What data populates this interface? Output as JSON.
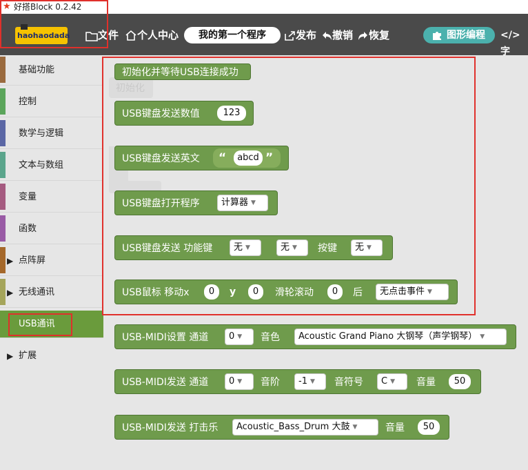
{
  "window": {
    "title": "好搭Block 0.2.42"
  },
  "header": {
    "logo_text": "haohaodada",
    "file_label": "文件",
    "personal_label": "个人中心",
    "project_name": "我的第一个程序",
    "publish_label": "发布",
    "undo_label": "撤销",
    "redo_label": "恢复",
    "graphic_tab_label": "图形编程",
    "code_tab_label": "字"
  },
  "sidebar": {
    "items": [
      {
        "label": "基础功能",
        "color": "#9a6a3e"
      },
      {
        "label": "控制",
        "color": "#5ba55b"
      },
      {
        "label": "数学与逻辑",
        "color": "#5b67a5"
      },
      {
        "label": "文本与数组",
        "color": "#5ba58c"
      },
      {
        "label": "变量",
        "color": "#a55b80"
      },
      {
        "label": "函数",
        "color": "#995ba5"
      },
      {
        "label": "点阵屏",
        "color": "#a5682a"
      },
      {
        "label": "无线通讯",
        "color": "#a5a55b"
      },
      {
        "label": "USB通讯",
        "selected": true,
        "color": "#6a9b3c"
      },
      {
        "label": "扩展"
      }
    ]
  },
  "ghost": {
    "label": "初始化"
  },
  "blocks": {
    "init": {
      "label": "初始化并等待USB连接成功"
    },
    "kb_num": {
      "label": "USB键盘发送数值",
      "value": "123"
    },
    "kb_str": {
      "label": "USB键盘发送英文",
      "open_quote": "“",
      "value": "abcd",
      "close_quote": "”"
    },
    "kb_open": {
      "label": "USB键盘打开程序",
      "value": "计算器"
    },
    "kb_key": {
      "label": "USB键盘发送 功能键",
      "mod1": "无",
      "mod2": "无",
      "key_label": "按键",
      "key": "无"
    },
    "mouse": {
      "label": "USB鼠标 移动x",
      "x": "0",
      "y_label": "y",
      "y": "0",
      "wheel_label": "滑轮滚动",
      "wheel": "0",
      "after_label": "后",
      "click": "无点击事件"
    },
    "midi_set": {
      "label": "USB-MIDI设置 通道",
      "channel": "0",
      "instrument_label": "音色",
      "instrument": "Acoustic Grand Piano 大钢琴（声学钢琴）"
    },
    "midi_note": {
      "label": "USB-MIDI发送 通道",
      "channel": "0",
      "scale_label": "音阶",
      "scale": "-1",
      "note_label": "音符号",
      "note": "C",
      "volume_label": "音量",
      "volume": "50"
    },
    "midi_drum": {
      "label": "USB-MIDI发送 打击乐",
      "drum": "Acoustic_Bass_Drum 大鼓",
      "volume_label": "音量",
      "volume": "50"
    }
  }
}
